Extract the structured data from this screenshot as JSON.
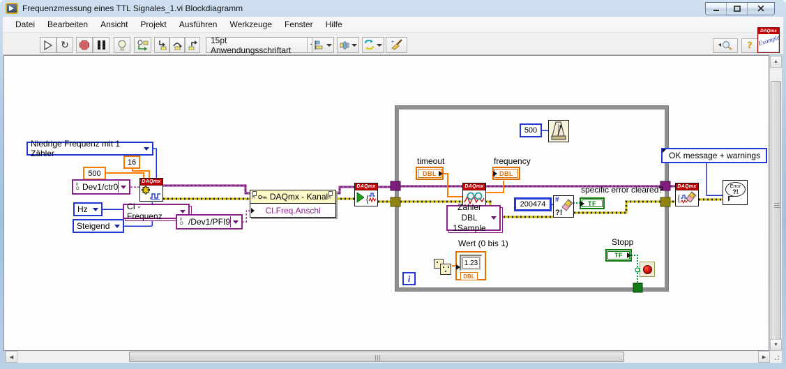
{
  "window": {
    "title": "Frequenzmessung eines TTL Signales_1.vi Blockdiagramm"
  },
  "menu": {
    "items": [
      "Datei",
      "Bearbeiten",
      "Ansicht",
      "Projekt",
      "Ausführen",
      "Werkzeuge",
      "Fenster",
      "Hilfe"
    ]
  },
  "toolbar": {
    "font_selector": "15pt Anwendungsschriftart",
    "help_label": "?"
  },
  "diagram": {
    "daqmx_label": "DAQmx",
    "vi_icon": {
      "top": "DAQmx",
      "script": "Example"
    },
    "enum_measurement": "Niedrige Frequenz mit 1 Zähler",
    "const_16": "16",
    "const_500": "500",
    "io_counter": "Dev1/ctr0",
    "enum_units": "Hz",
    "selector_channel": "CI - Frequenz",
    "enum_edge": "Steigend",
    "io_terminal": "/Dev1/PFI9",
    "property_node": {
      "title": "DAQmx - Kanal",
      "property": "CI.Freq.Anschl",
      "corner": "?!"
    },
    "loop": {
      "wait_ms": "500",
      "timeout_label": "timeout",
      "frequency_label": "frequency",
      "dbl": "DBL",
      "selector_read_line1": "Zähler DBL",
      "selector_read_line2": "1Sample",
      "error_code": "200474",
      "clear_error_icon": {
        "hash": "#",
        "marks": "?!"
      },
      "cleared_label": "specific error cleared?",
      "tf": "TF",
      "random_label": "Wert (0 bis 1)",
      "random_value": "1.23",
      "iteration_label": "i",
      "stop_label": "Stopp"
    },
    "ring_error_action": "OK message + warnings",
    "error_handler": {
      "word": "Error",
      "marks": "?!"
    }
  },
  "colors": {
    "accent_blue": "#2238d4",
    "numeric_orange": "#f57c00",
    "daqmx_purple": "#8b1f8b",
    "bool_green": "#0c7a0c",
    "error_wire": "#c9b60b",
    "task_wire": "#7d1e7d",
    "daqmx_red": "#be0202",
    "loop_gray": "#8f8f8f",
    "titlebar_blue": "#b4cce4"
  }
}
